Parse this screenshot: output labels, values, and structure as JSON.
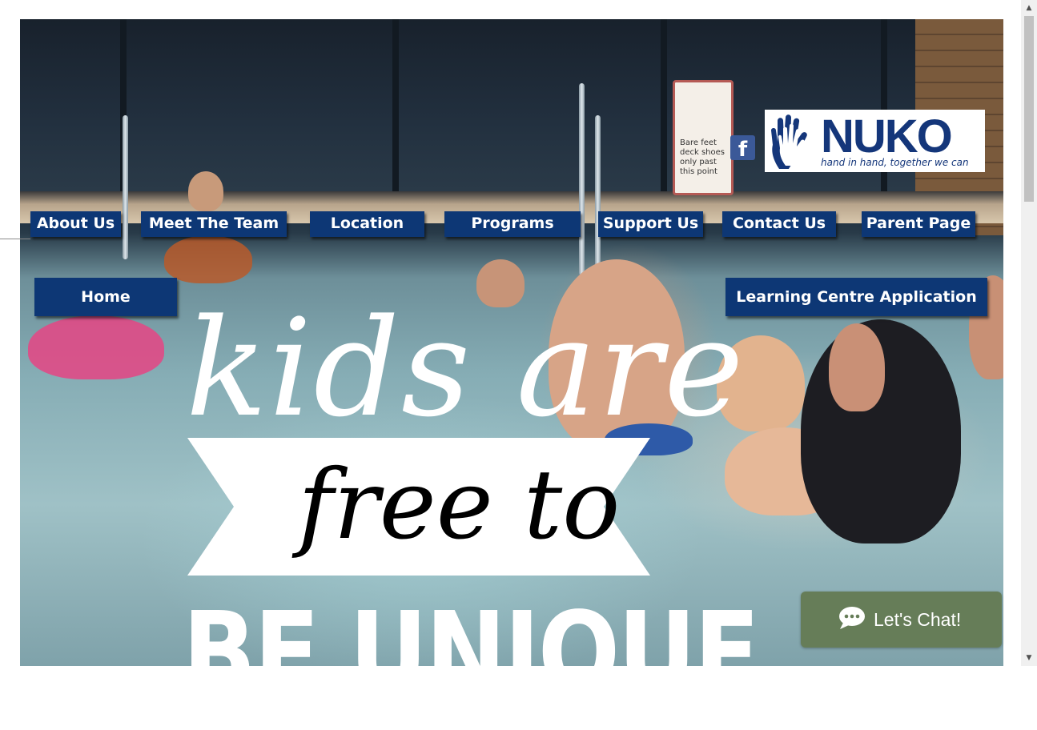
{
  "header": {
    "social": {
      "facebook_glyph": "f",
      "icon": "facebook-icon"
    },
    "logo": {
      "brand": "NUKO",
      "tagline": "hand in hand, together we can",
      "icon": "hand-logo-icon",
      "color": "#14367a"
    }
  },
  "nav": {
    "items": [
      {
        "label": "About Us"
      },
      {
        "label": "Meet The Team"
      },
      {
        "label": "Location"
      },
      {
        "label": "Programs"
      },
      {
        "label": "Support Us"
      },
      {
        "label": "Contact Us"
      },
      {
        "label": "Parent Page"
      },
      {
        "label": "Home"
      },
      {
        "label": "Learning Centre Application"
      }
    ],
    "color": "#0d3775"
  },
  "hero": {
    "line1": "kids are",
    "line2": "free to",
    "line3": "BE UNIQUE",
    "sign_text": "Bare feet deck shoes only past this point"
  },
  "chat": {
    "label": "Let's Chat!",
    "icon": "chat-bubble-icon",
    "color": "#667d58"
  },
  "scrollbar": {
    "up_icon": "arrow-up-icon",
    "down_icon": "arrow-down-icon"
  }
}
